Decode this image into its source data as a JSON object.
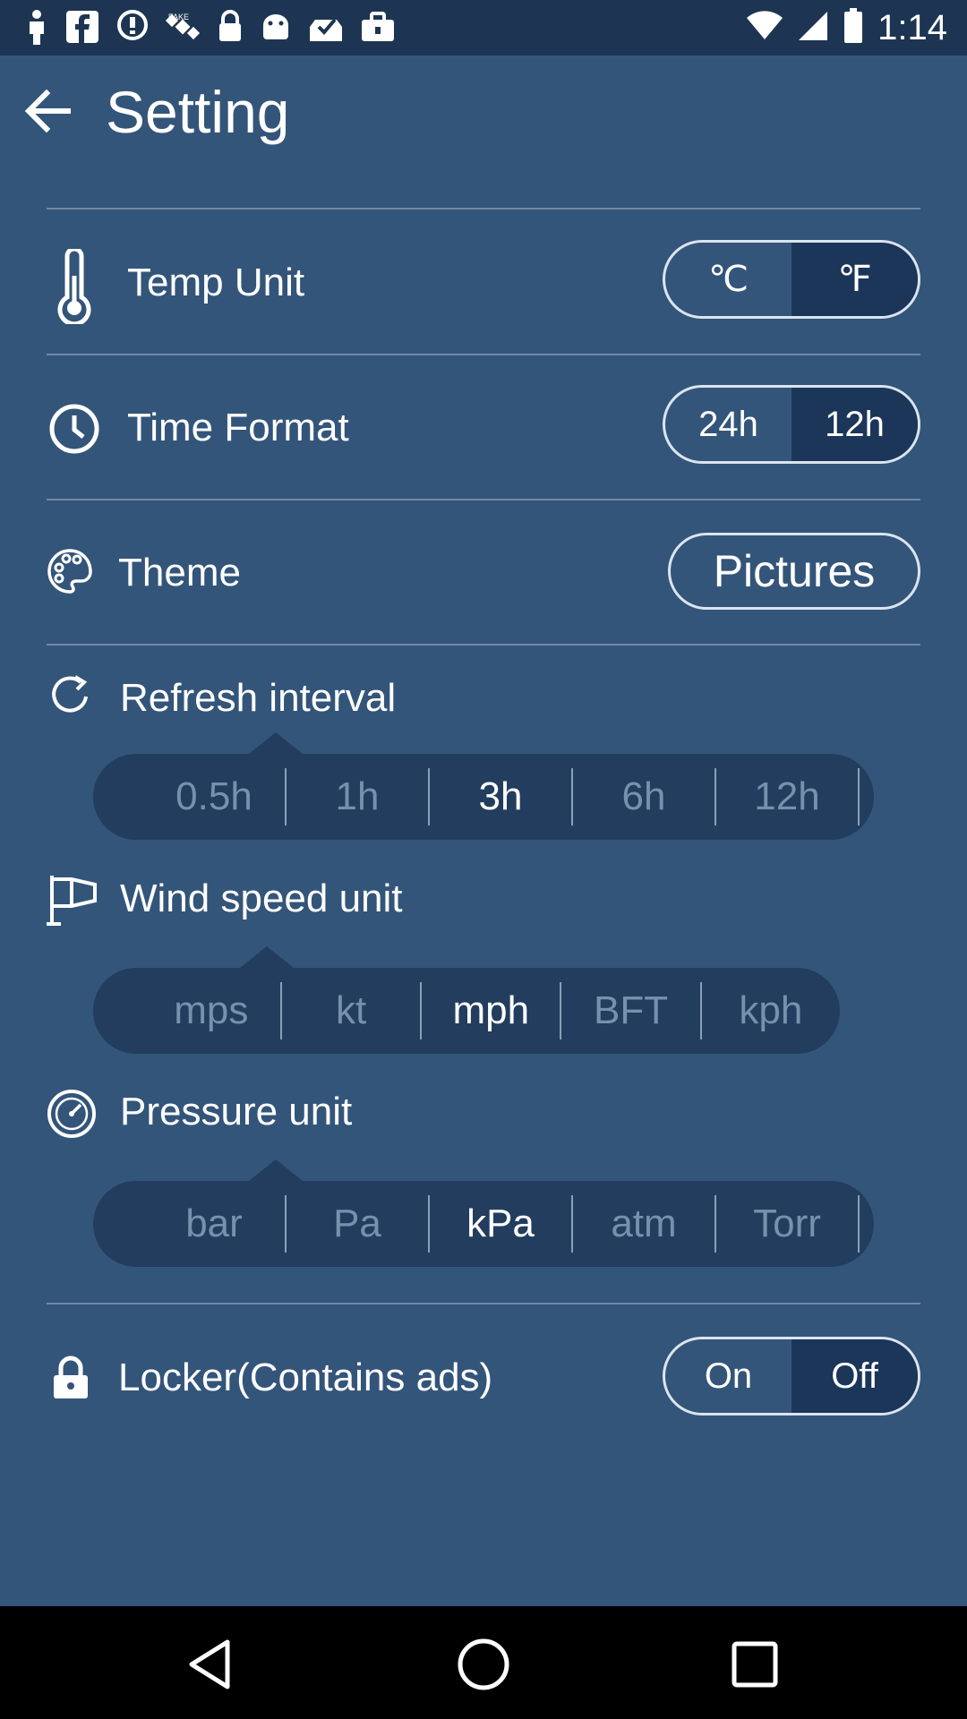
{
  "status_bar": {
    "time": "1:14",
    "icons": [
      "person-icon",
      "facebook-icon",
      "signal-boost-icon",
      "satellite-icon",
      "lock-icon",
      "android-icon",
      "inbox-check-icon",
      "briefcase-icon"
    ]
  },
  "header": {
    "title": "Setting"
  },
  "temp_unit": {
    "label": "Temp Unit",
    "options": [
      "℃",
      "℉"
    ],
    "selected": "℉"
  },
  "time_format": {
    "label": "Time Format",
    "options": [
      "24h",
      "12h"
    ],
    "selected": "12h"
  },
  "theme": {
    "label": "Theme",
    "value": "Pictures"
  },
  "refresh_interval": {
    "label": "Refresh interval",
    "options": [
      "0.5h",
      "1h",
      "3h",
      "6h",
      "12h"
    ],
    "selected": "3h"
  },
  "wind_speed_unit": {
    "label": "Wind speed unit",
    "options": [
      "mps",
      "kt",
      "mph",
      "BFT",
      "kph"
    ],
    "selected": "mph"
  },
  "pressure_unit": {
    "label": "Pressure unit",
    "options": [
      "bar",
      "Pa",
      "kPa",
      "atm",
      "Torr"
    ],
    "selected": "kPa"
  },
  "locker": {
    "label": "Locker(Contains ads)",
    "options": [
      "On",
      "Off"
    ],
    "selected": "Off"
  },
  "colors": {
    "background": "#34557a",
    "status_bar": "#1d3552",
    "selected_segment": "#1c365a",
    "slider_track": "#223d5e"
  }
}
